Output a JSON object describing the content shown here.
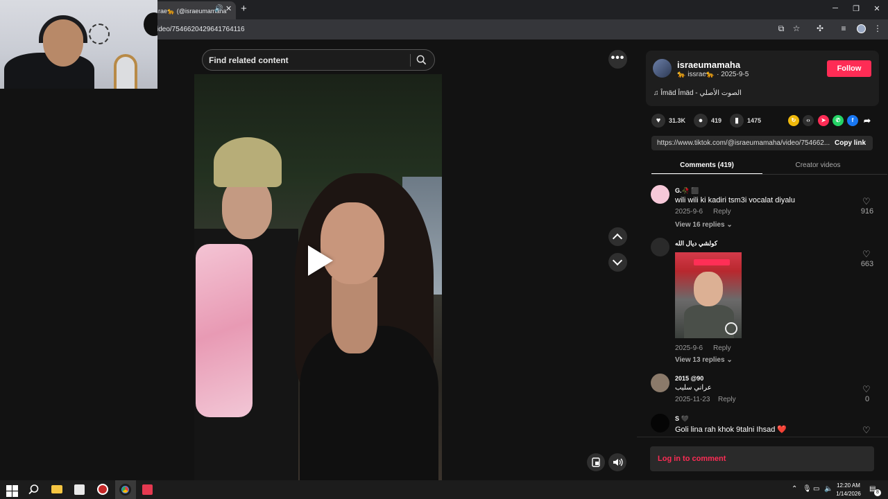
{
  "browser": {
    "tab_title": "rae🐆 (@israeumamaha",
    "tab_audio_icon": "🔊",
    "url": "ideo/7546620429641764116",
    "colors": {
      "tabbar": "#202124",
      "addressbar": "#35363a"
    }
  },
  "webcam": {
    "description_icon": "webcam-feed"
  },
  "video": {
    "search_placeholder": "Find related content",
    "more_label": "•••"
  },
  "author": {
    "username": "israeumamaha",
    "nickname": "🐆 issrae🐆",
    "date": "2025-9-5",
    "follow_label": "Follow",
    "music": "Îmäd Îmäd - الصوت الأصلي"
  },
  "stats": {
    "likes": "31.3K",
    "comments": "419",
    "saves": "1475"
  },
  "share": {
    "link": "https://www.tiktok.com/@israeumamaha/video/754662...",
    "copy_label": "Copy link"
  },
  "tabs": {
    "comments": "Comments (419)",
    "creator": "Creator videos"
  },
  "comments": [
    {
      "name": "G.🥀 ⬛",
      "text": "wili wili ki kadiri tsm3i vocalat diyalu",
      "date": "2025-9-6",
      "reply": "Reply",
      "replies": "View 16 replies",
      "likes": "916"
    },
    {
      "name": "كولشي ديال الله",
      "text": "",
      "date": "2025-9-6",
      "reply": "Reply",
      "replies": "View 13 replies",
      "likes": "663"
    },
    {
      "name": "2015 @90",
      "text": "عراني سليب",
      "date": "2025-11-23",
      "reply": "Reply",
      "replies": "",
      "likes": "0"
    },
    {
      "name": "S 🖤",
      "text": "Goli lina rah khok 9talni Ihsad ❤️",
      "date": "",
      "reply": "",
      "replies": "",
      "likes": ""
    }
  ],
  "comment_input": {
    "login_label": "Log in to comment"
  },
  "taskbar": {
    "time": "12:20 AM",
    "date": "1/14/2026",
    "notification_count": "8"
  },
  "accent_color": "#fe2c55"
}
